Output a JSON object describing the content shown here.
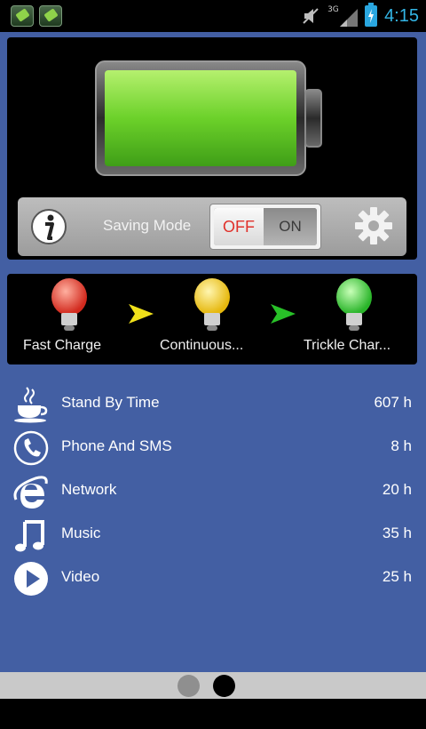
{
  "status_bar": {
    "time": "4:15",
    "network_type": "3G",
    "colors": {
      "time": "#33b5e5",
      "battery": "#2aa7e0"
    }
  },
  "battery_display": {
    "level_fraction": 1.0,
    "fill_color": "#8fe04a"
  },
  "mode_bar": {
    "label": "Saving Mode",
    "toggle": {
      "off_label": "OFF",
      "on_label": "ON",
      "state": "OFF"
    },
    "info_icon": "info-icon",
    "settings_icon": "gear-icon"
  },
  "charge_stages": [
    {
      "label": "Fast Charge",
      "bulb_color": "#e8362a"
    },
    {
      "label": "Continuous...",
      "bulb_color": "#f3d21c"
    },
    {
      "label": "Trickle Char...",
      "bulb_color": "#3ad83a"
    }
  ],
  "usage": [
    {
      "icon": "coffee-cup-icon",
      "label": "Stand By Time",
      "value": "607 h"
    },
    {
      "icon": "phone-icon",
      "label": "Phone And SMS",
      "value": "8 h"
    },
    {
      "icon": "internet-explorer-icon",
      "label": "Network",
      "value": "20 h"
    },
    {
      "icon": "music-note-icon",
      "label": "Music",
      "value": "35 h"
    },
    {
      "icon": "play-icon",
      "label": "Video",
      "value": "25 h"
    }
  ],
  "pager": {
    "pages": 2,
    "active_page": 2
  },
  "colors": {
    "background": "#435fa3",
    "panel": "#000000"
  }
}
